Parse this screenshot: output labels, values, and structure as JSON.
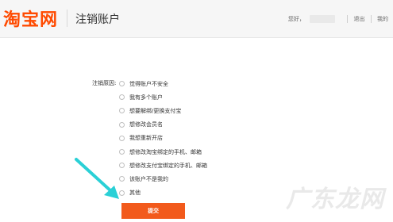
{
  "header": {
    "logo_text": "淘宝网",
    "title": "注销账户",
    "greeting": "您好，",
    "logout": "退出",
    "help": "我的"
  },
  "form": {
    "label": "注销原因:",
    "options": [
      "觉得账户不安全",
      "我有多个账户",
      "想要解绑/更换支付宝",
      "想修改会员名",
      "我想重新开店",
      "想修改淘宝绑定的手机、邮箱",
      "想修改支付宝绑定的手机、邮箱",
      "该账户不是我的",
      "其他"
    ],
    "submit_label": "提交"
  },
  "watermark": "广东龙网",
  "colors": {
    "brand": "#ff4a00",
    "submit_bg": "#f25a1c",
    "annotation_arrow": "#2ad0d6"
  },
  "annotation": {
    "icon": "cyan-arrow-pointing-at-submit"
  }
}
